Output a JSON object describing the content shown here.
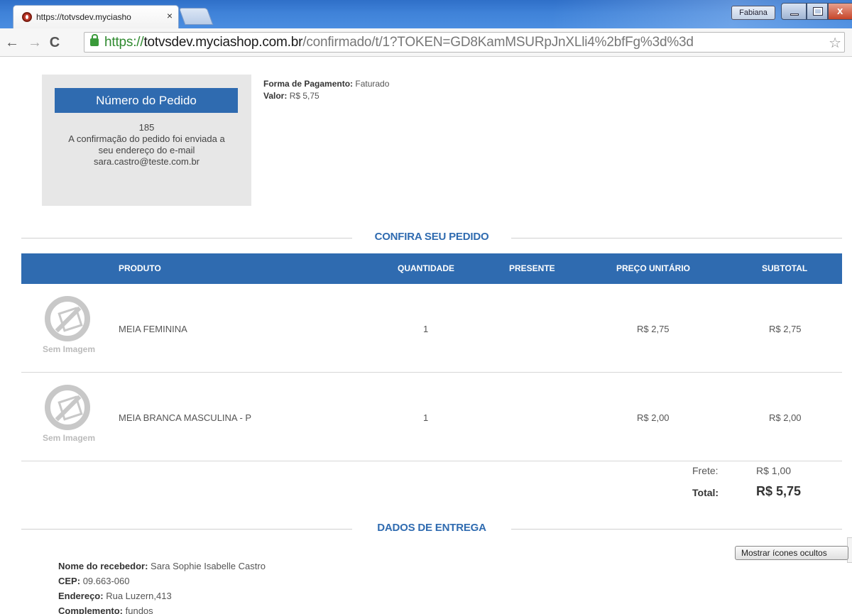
{
  "browser": {
    "tab_title": "https://totvsdev.myciasho",
    "tab_close": "×",
    "user_name": "Fabiana",
    "url_scheme": "https://",
    "url_host": "totvsdev.myciashop.com.br",
    "url_path": "/confirmado/t/1?TOKEN=GD8KamMSURpJnXLli4%2bfFg%3d%3d",
    "icons": {
      "back": "←",
      "forward": "→",
      "reload": "C",
      "star": "☆"
    }
  },
  "order": {
    "title": "Número do Pedido",
    "number": "185",
    "message_line1": "A confirmação do pedido foi enviada a",
    "message_line2": "seu endereço do e-mail",
    "email": "sara.castro@teste.com.br"
  },
  "payment": {
    "method_label": "Forma de Pagamento:",
    "method_value": "Faturado",
    "amount_label": "Valor:",
    "amount_value": "R$ 5,75"
  },
  "review_heading": "CONFIRA SEU PEDIDO",
  "table": {
    "headers": {
      "product": "PRODUTO",
      "quantity": "QUANTIDADE",
      "gift": "PRESENTE",
      "unit_price": "PREÇO UNITÁRIO",
      "subtotal": "SUBTOTAL"
    },
    "no_image_caption": "Sem Imagem",
    "rows": [
      {
        "product": "MEIA FEMININA",
        "quantity": "1",
        "gift": "",
        "unit_price": "R$ 2,75",
        "subtotal": "R$ 2,75"
      },
      {
        "product": "MEIA BRANCA MASCULINA - P",
        "quantity": "1",
        "gift": "",
        "unit_price": "R$ 2,00",
        "subtotal": "R$ 2,00"
      }
    ]
  },
  "totals": {
    "shipping_label": "Frete:",
    "shipping_value": "R$ 1,00",
    "total_label": "Total:",
    "total_value": "R$ 5,75"
  },
  "delivery_heading": "DADOS DE ENTREGA",
  "delivery": {
    "receiver_label": "Nome do recebedor:",
    "receiver_value": "Sara Sophie Isabelle Castro",
    "cep_label": "CEP:",
    "cep_value": "09.663-060",
    "address_label": "Endereço:",
    "address_value": "Rua Luzern,413",
    "complement_label": "Complemento:",
    "complement_value": "fundos"
  },
  "hidden_icons_button": "Mostrar ícones ocultos"
}
